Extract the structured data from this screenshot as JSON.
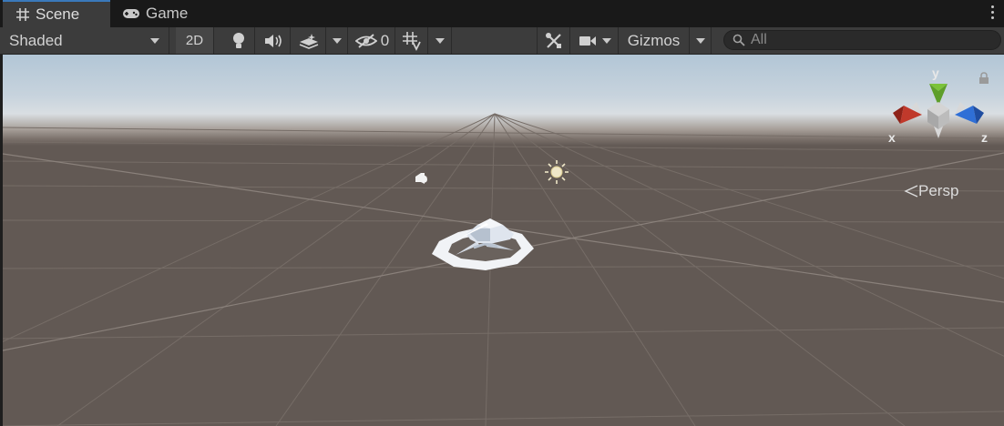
{
  "tabs": [
    {
      "label": "Scene",
      "icon": "grid-hash-icon",
      "active": true
    },
    {
      "label": "Game",
      "icon": "gamepad-icon",
      "active": false
    }
  ],
  "toolbar": {
    "shading_mode": "Shaded",
    "mode_2d": "2D",
    "hidden_count": "0",
    "gizmos_label": "Gizmos",
    "search_placeholder": "All"
  },
  "scene": {
    "projection_label": "Persp",
    "axis_labels": {
      "x": "x",
      "y": "y",
      "z": "z"
    }
  },
  "colors": {
    "tab_accent": "#3a79bb",
    "ground": "#625954",
    "axis_x": "#c0392b",
    "axis_y": "#7bc33a",
    "axis_z": "#2f6fd6"
  }
}
